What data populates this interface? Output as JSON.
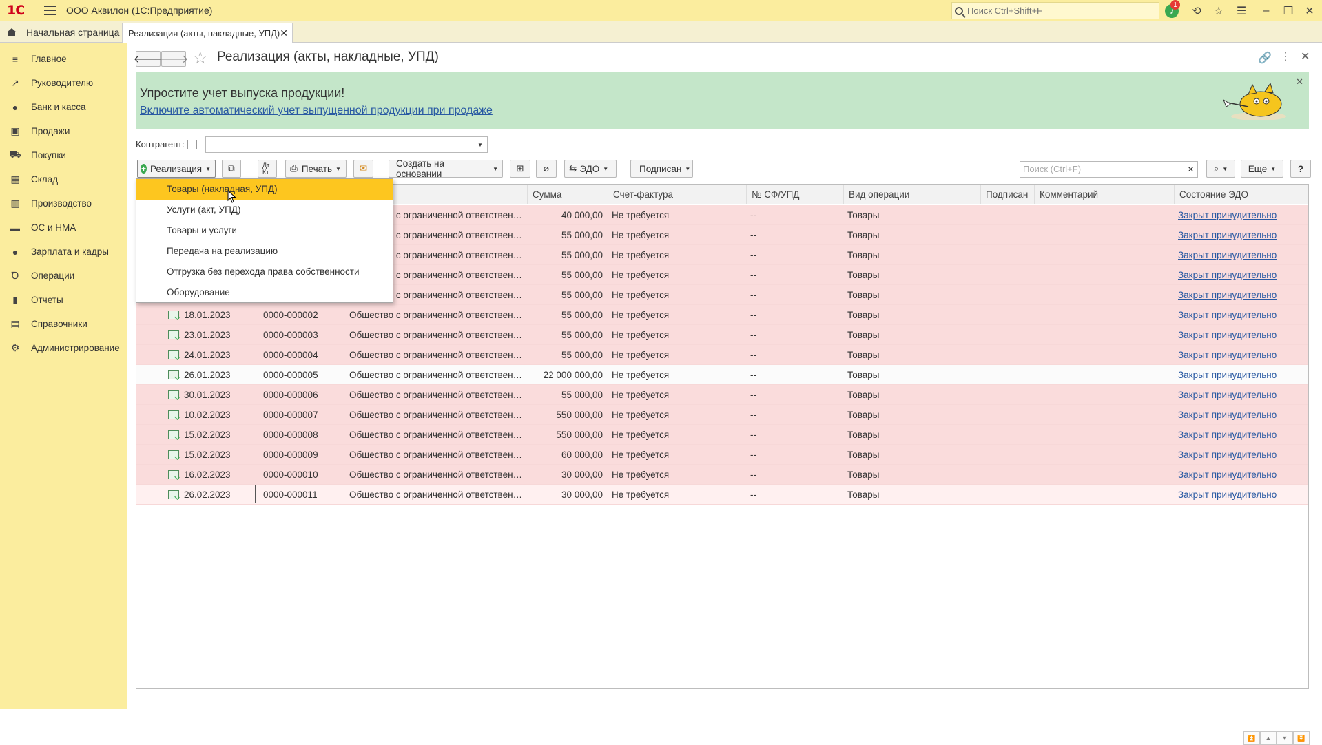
{
  "app": {
    "logo": "1С",
    "title": "ООО Аквилон  (1С:Предприятие)",
    "search_placeholder": "Поиск Ctrl+Shift+F",
    "notification_count": "1"
  },
  "tabs": {
    "home": "Начальная страница",
    "current": "Реализация (акты, накладные, УПД)"
  },
  "sidebar": {
    "items": [
      {
        "label": "Главное",
        "icon": "≡"
      },
      {
        "label": "Руководителю",
        "icon": "↗"
      },
      {
        "label": "Банк и касса",
        "icon": "●"
      },
      {
        "label": "Продажи",
        "icon": "▣"
      },
      {
        "label": "Покупки",
        "icon": "⛟"
      },
      {
        "label": "Склад",
        "icon": "▦"
      },
      {
        "label": "Производство",
        "icon": "▥"
      },
      {
        "label": "ОС и НМА",
        "icon": "▬"
      },
      {
        "label": "Зарплата и кадры",
        "icon": "●"
      },
      {
        "label": "Операции",
        "icon": "Ꝺ"
      },
      {
        "label": "Отчеты",
        "icon": "▮"
      },
      {
        "label": "Справочники",
        "icon": "▤"
      },
      {
        "label": "Администрирование",
        "icon": "⚙"
      }
    ]
  },
  "form": {
    "title": "Реализация (акты, накладные, УПД)"
  },
  "banner": {
    "title": "Упростите учет выпуска продукции!",
    "link": "Включите автоматический учет выпущенной продукции при продаже"
  },
  "filter": {
    "label": "Контрагент:",
    "value": ""
  },
  "toolbar": {
    "create": "Реализация",
    "dtkt": "Дт Кт",
    "print": "Печать",
    "based_on": "Создать на основании",
    "edo": "ЭДО",
    "signed": "Подписан",
    "search_placeholder": "Поиск (Ctrl+F)",
    "more": "Еще",
    "help": "?"
  },
  "dropdown": {
    "items": [
      "Товары (накладная, УПД)",
      "Услуги (акт, УПД)",
      "Товары и услуги",
      "Передача на реализацию",
      "Отгрузка без перехода права собственности",
      "Оборудование"
    ]
  },
  "table": {
    "headers": {
      "sum": "Сумма",
      "invoice": "Счет-фактура",
      "sfupd": "№ СФ/УПД",
      "operation": "Вид операции",
      "signed": "Подписан",
      "comment": "Комментарий",
      "edo": "Состояние ЭДО"
    },
    "rows": [
      {
        "date": "",
        "number": "",
        "counterparty": "Общество с ограниченной ответствен…",
        "sum": "40 000,00",
        "invoice": "Не требуется",
        "sfupd": "--",
        "operation": "Товары",
        "edo": "Закрыт принудительно"
      },
      {
        "date": "",
        "number": "",
        "counterparty": "Общество с ограниченной ответствен…",
        "sum": "55 000,00",
        "invoice": "Не требуется",
        "sfupd": "--",
        "operation": "Товары",
        "edo": "Закрыт принудительно"
      },
      {
        "date": "",
        "number": "",
        "counterparty": "Общество с ограниченной ответствен…",
        "sum": "55 000,00",
        "invoice": "Не требуется",
        "sfupd": "--",
        "operation": "Товары",
        "edo": "Закрыт принудительно"
      },
      {
        "date": "",
        "number": "",
        "counterparty": "Общество с ограниченной ответствен…",
        "sum": "55 000,00",
        "invoice": "Не требуется",
        "sfupd": "--",
        "operation": "Товары",
        "edo": "Закрыт принудительно"
      },
      {
        "date": "",
        "number": "",
        "counterparty": "Общество с ограниченной ответствен…",
        "sum": "55 000,00",
        "invoice": "Не требуется",
        "sfupd": "--",
        "operation": "Товары",
        "edo": "Закрыт принудительно"
      },
      {
        "date": "18.01.2023",
        "number": "0000-000002",
        "counterparty": "Общество с ограниченной ответствен…",
        "sum": "55 000,00",
        "invoice": "Не требуется",
        "sfupd": "--",
        "operation": "Товары",
        "edo": "Закрыт принудительно"
      },
      {
        "date": "23.01.2023",
        "number": "0000-000003",
        "counterparty": "Общество с ограниченной ответствен…",
        "sum": "55 000,00",
        "invoice": "Не требуется",
        "sfupd": "--",
        "operation": "Товары",
        "edo": "Закрыт принудительно"
      },
      {
        "date": "24.01.2023",
        "number": "0000-000004",
        "counterparty": "Общество с ограниченной ответствен…",
        "sum": "55 000,00",
        "invoice": "Не требуется",
        "sfupd": "--",
        "operation": "Товары",
        "edo": "Закрыт принудительно"
      },
      {
        "date": "26.01.2023",
        "number": "0000-000005",
        "counterparty": "Общество с ограниченной ответствен…",
        "sum": "22 000 000,00",
        "invoice": "Не требуется",
        "sfupd": "--",
        "operation": "Товары",
        "edo": "Закрыт принудительно"
      },
      {
        "date": "30.01.2023",
        "number": "0000-000006",
        "counterparty": "Общество с ограниченной ответствен…",
        "sum": "55 000,00",
        "invoice": "Не требуется",
        "sfupd": "--",
        "operation": "Товары",
        "edo": "Закрыт принудительно"
      },
      {
        "date": "10.02.2023",
        "number": "0000-000007",
        "counterparty": "Общество с ограниченной ответствен…",
        "sum": "550 000,00",
        "invoice": "Не требуется",
        "sfupd": "--",
        "operation": "Товары",
        "edo": "Закрыт принудительно"
      },
      {
        "date": "15.02.2023",
        "number": "0000-000008",
        "counterparty": "Общество с ограниченной ответствен…",
        "sum": "550 000,00",
        "invoice": "Не требуется",
        "sfupd": "--",
        "operation": "Товары",
        "edo": "Закрыт принудительно"
      },
      {
        "date": "15.02.2023",
        "number": "0000-000009",
        "counterparty": "Общество с ограниченной ответствен…",
        "sum": "60 000,00",
        "invoice": "Не требуется",
        "sfupd": "--",
        "operation": "Товары",
        "edo": "Закрыт принудительно"
      },
      {
        "date": "16.02.2023",
        "number": "0000-000010",
        "counterparty": "Общество с ограниченной ответствен…",
        "sum": "30 000,00",
        "invoice": "Не требуется",
        "sfupd": "--",
        "operation": "Товары",
        "edo": "Закрыт принудительно"
      },
      {
        "date": "26.02.2023",
        "number": "0000-000011",
        "counterparty": "Общество с ограниченной ответствен…",
        "sum": "30 000,00",
        "invoice": "Не требуется",
        "sfupd": "--",
        "operation": "Товары",
        "edo": "Закрыт принудительно"
      }
    ]
  }
}
